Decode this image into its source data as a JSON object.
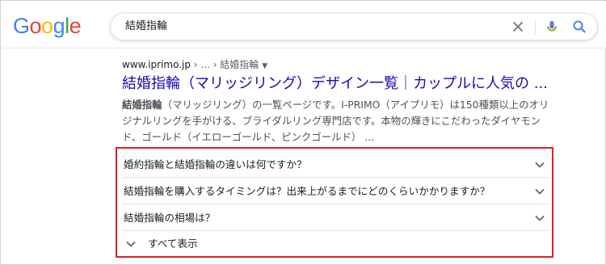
{
  "logo": {
    "letters": [
      "G",
      "o",
      "o",
      "g",
      "l",
      "e"
    ],
    "colors": [
      "#4285F4",
      "#EA4335",
      "#FBBC05",
      "#4285F4",
      "#34A853",
      "#EA4335"
    ]
  },
  "search": {
    "query": "結婚指輪",
    "icons": [
      "close-icon",
      "mic-icon",
      "search-icon"
    ]
  },
  "result": {
    "domain": "www.iprimo.jp",
    "path": " › ... › 結婚指輪",
    "title": "結婚指輪（マリッジリング）デザイン一覧｜カップルに人気の ...",
    "snippet_bold": "結婚指輪",
    "snippet_line1_rest": "（マリッジリング）の一覧ページです。I-PRIMO（アイプリモ）は150種類以上のオリ",
    "snippet_line2": "ジナルリングを手がける、ブライダルリング専門店です。本物の輝きにこだわったダイヤモン",
    "snippet_line3": "ド、ゴールド（イエローゴールド、ピンクゴールド） ..."
  },
  "paa": {
    "questions": [
      "婚約指輪と結婚指輪の違いは何ですか？",
      "結婚指輪を購入するタイミングは？出来上がるまでにどのくらいかかりますか？",
      "結婚指輪の相場は？"
    ],
    "show_all": "すべて表示"
  },
  "colors": {
    "link": "#1a0dab",
    "highlight_border": "#e02020"
  }
}
